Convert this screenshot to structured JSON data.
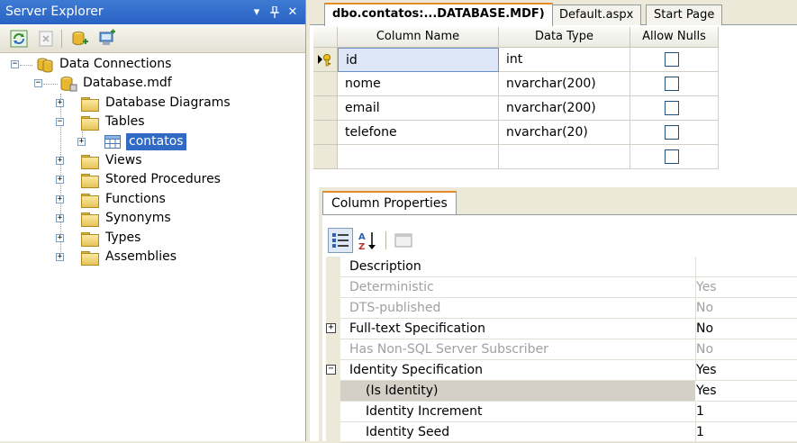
{
  "server_explorer": {
    "title": "Server Explorer",
    "title_buttons": [
      "▾",
      "ᵖ",
      "✕"
    ],
    "tree": [
      {
        "label": "Data Connections",
        "icon": "data-connections-icon",
        "expander": "−"
      },
      {
        "label": "Database.mdf",
        "icon": "database-icon",
        "expander": "−"
      },
      {
        "label": "Database Diagrams",
        "icon": "folder-icon",
        "expander": "+"
      },
      {
        "label": "Tables",
        "icon": "folder-icon",
        "expander": "−"
      },
      {
        "label": "contatos",
        "icon": "table-icon",
        "expander": "+",
        "selected": true
      },
      {
        "label": "Views",
        "icon": "folder-icon",
        "expander": "+"
      },
      {
        "label": "Stored Procedures",
        "icon": "folder-icon",
        "expander": "+"
      },
      {
        "label": "Functions",
        "icon": "folder-icon",
        "expander": "+"
      },
      {
        "label": "Synonyms",
        "icon": "folder-icon",
        "expander": "+"
      },
      {
        "label": "Types",
        "icon": "folder-icon",
        "expander": "+"
      },
      {
        "label": "Assemblies",
        "icon": "folder-icon",
        "expander": "+"
      }
    ]
  },
  "tabs": [
    {
      "label": "dbo.contatos:...DATABASE.MDF)",
      "active": true
    },
    {
      "label": "Default.aspx",
      "active": false
    },
    {
      "label": "Start Page",
      "active": false
    }
  ],
  "table_designer": {
    "columns": [
      "Column Name",
      "Data Type",
      "Allow Nulls"
    ],
    "rows": [
      {
        "name": "id",
        "type": "int",
        "allow_nulls": false,
        "primary_key": true
      },
      {
        "name": "nome",
        "type": "nvarchar(200)",
        "allow_nulls": false
      },
      {
        "name": "email",
        "type": "nvarchar(200)",
        "allow_nulls": false
      },
      {
        "name": "telefone",
        "type": "nvarchar(20)",
        "allow_nulls": false
      },
      {
        "name": "",
        "type": "",
        "allow_nulls": false
      }
    ]
  },
  "column_properties": {
    "tab_label": "Column Properties",
    "properties": [
      {
        "name": "Description",
        "value": "",
        "state": "normal"
      },
      {
        "name": "Deterministic",
        "value": "Yes",
        "state": "dim"
      },
      {
        "name": "DTS-published",
        "value": "No",
        "state": "dim"
      },
      {
        "name": "Full-text Specification",
        "value": "No",
        "state": "normal",
        "expander": "+"
      },
      {
        "name": "Has Non-SQL Server Subscriber",
        "value": "No",
        "state": "dim"
      },
      {
        "name": "Identity Specification",
        "value": "Yes",
        "state": "normal",
        "expander": "−"
      },
      {
        "name": "(Is Identity)",
        "value": "Yes",
        "state": "selected",
        "indent": true
      },
      {
        "name": "Identity Increment",
        "value": "1",
        "state": "normal",
        "indent": true
      },
      {
        "name": "Identity Seed",
        "value": "1",
        "state": "normal",
        "indent": true
      }
    ]
  }
}
